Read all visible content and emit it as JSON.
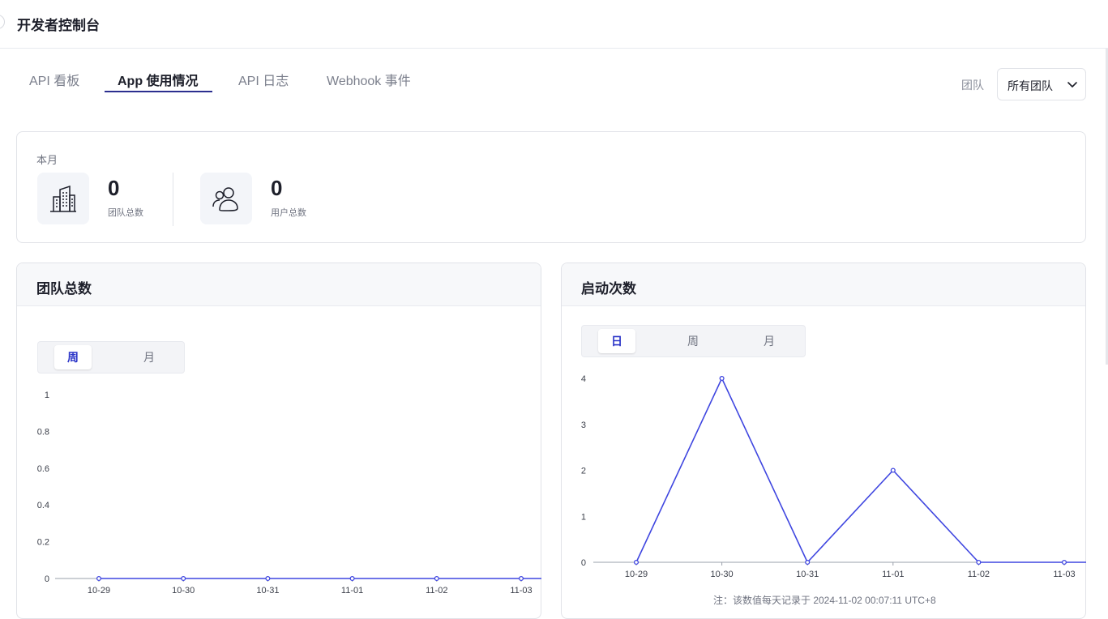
{
  "app": {
    "title": "开发者控制台"
  },
  "tabs": [
    {
      "label": "API 看板"
    },
    {
      "label": "App 使用情况"
    },
    {
      "label": "API 日志"
    },
    {
      "label": "Webhook 事件"
    }
  ],
  "team_filter": {
    "label": "团队",
    "value": "所有团队",
    "icon": "chevron-down-icon"
  },
  "stats": {
    "period": "本月",
    "items": [
      {
        "value": "0",
        "label": "团队总数",
        "icon": "building-icon"
      },
      {
        "value": "0",
        "label": "用户总数",
        "icon": "users-icon"
      }
    ]
  },
  "panels": {
    "teams": {
      "title": "团队总数",
      "segments": [
        "周",
        "月"
      ],
      "active": "周"
    },
    "launches": {
      "title": "启动次数",
      "segments": [
        "日",
        "周",
        "月"
      ],
      "active": "日",
      "note": "注：该数值每天记录于 2024-11-02 00:07:11 UTC+8"
    }
  },
  "colors": {
    "accent": "#2b35c8",
    "line": "#3f46e0"
  },
  "chart_data": [
    {
      "type": "line",
      "title": "团队总数",
      "categories": [
        "10-29",
        "10-30",
        "10-31",
        "11-01",
        "11-02",
        "11-03"
      ],
      "values": [
        0,
        0,
        0,
        0,
        0,
        0
      ],
      "yticks": [
        "0",
        "0.2",
        "0.4",
        "0.6",
        "0.8",
        "1"
      ],
      "ylim": [
        0,
        1
      ],
      "grid": false
    },
    {
      "type": "line",
      "title": "启动次数",
      "categories": [
        "10-29",
        "10-30",
        "10-31",
        "11-01",
        "11-02",
        "11-03"
      ],
      "values": [
        0,
        4,
        0,
        2,
        0,
        0
      ],
      "yticks": [
        "0",
        "1",
        "2",
        "3",
        "4"
      ],
      "ylim": [
        0,
        4
      ],
      "grid": false
    }
  ]
}
